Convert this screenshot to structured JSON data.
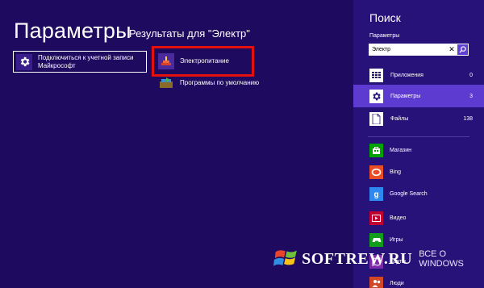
{
  "main": {
    "title": "Параметры",
    "results_header": "Результаты для \"Электр\"",
    "results": [
      {
        "label": "Подключиться к учетной записи Майкрософт",
        "icon": "gear-icon"
      },
      {
        "label": "Электропитание",
        "icon": "power-options-icon"
      },
      {
        "label": "Программы по умолчанию",
        "icon": "default-programs-icon"
      }
    ],
    "highlight_color": "#e3100f"
  },
  "charm": {
    "title": "Поиск",
    "scope_label": "Параметры",
    "search": {
      "value": "Электр",
      "placeholder": ""
    },
    "categories": [
      {
        "label": "Приложения",
        "count": "0",
        "icon": "apps-icon"
      },
      {
        "label": "Параметры",
        "count": "3",
        "icon": "gear-icon",
        "selected": true
      },
      {
        "label": "Файлы",
        "count": "138",
        "icon": "file-icon"
      }
    ],
    "apps": [
      {
        "label": "Магазин",
        "icon": "store-icon",
        "color": "#00a300"
      },
      {
        "label": "Bing",
        "icon": "bing-icon",
        "color": "#e94e26"
      },
      {
        "label": "Google Search",
        "icon": "google-search-icon",
        "color": "#2d89ef"
      },
      {
        "label": "Видео",
        "icon": "video-icon",
        "color": "#c1002f"
      },
      {
        "label": "Игры",
        "icon": "games-icon",
        "color": "#119d1b"
      },
      {
        "label": "Карты",
        "icon": "maps-icon",
        "color": "#7e2bab"
      },
      {
        "label": "Люди",
        "icon": "people-icon",
        "color": "#d24726"
      }
    ]
  },
  "watermark": {
    "main": "SOFTREW.RU",
    "sub": "ВСЕ О WINDOWS"
  },
  "colors": {
    "background": "#1e0a5e",
    "charm_background": "#27127a",
    "selected": "#5d3bd1"
  }
}
